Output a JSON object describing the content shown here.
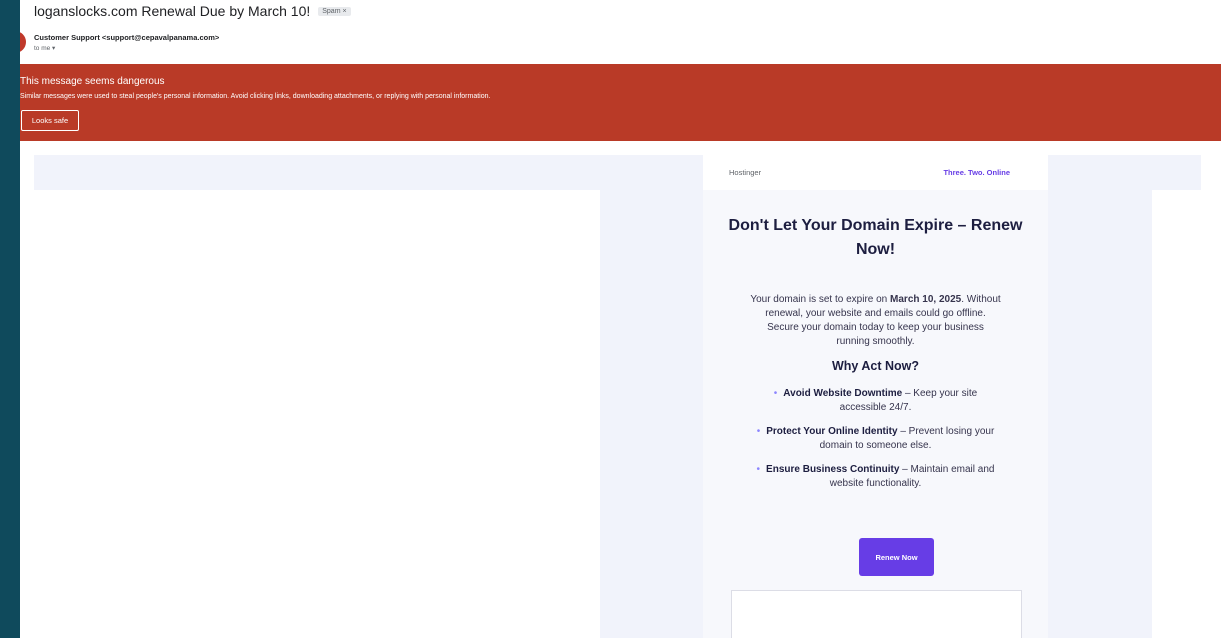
{
  "email": {
    "subject": "loganslocks.com Renewal Due by March 10!",
    "spam_label": "Spam ×",
    "sender": "Customer Support <support@cepavalpanama.com>",
    "to_line": "to me ▾"
  },
  "warning": {
    "title": "This message seems dangerous",
    "text": "Similar messages were used to steal people's personal information. Avoid clicking links, downloading attachments, or replying with personal information.",
    "button_label": "Looks safe"
  },
  "message": {
    "logo_alt": "Hostinger",
    "tagline": "Three. Two. Online",
    "headline": "Don't Let Your Domain Expire – Renew Now!",
    "intro_before": "Your domain is set to expire on ",
    "intro_date": "March 10, 2025",
    "intro_after": ". Without renewal, your website and emails could go offline. Secure your domain today to keep your business running smoothly.",
    "why_title": "Why Act Now?",
    "bullets": [
      {
        "bold": "Avoid Website Downtime",
        "text": " – Keep your site accessible 24/7."
      },
      {
        "bold": "Protect Your Online Identity",
        "text": " – Prevent losing your domain to someone else."
      },
      {
        "bold": "Ensure Business Continuity",
        "text": " – Maintain email and website functionality."
      }
    ],
    "cta_label": "Renew Now"
  },
  "colors": {
    "outer_background": "#0f4a5c",
    "warning_banner": "#b93a27",
    "brand_purple": "#673de6",
    "email_body_background": "#f1f3fb"
  }
}
